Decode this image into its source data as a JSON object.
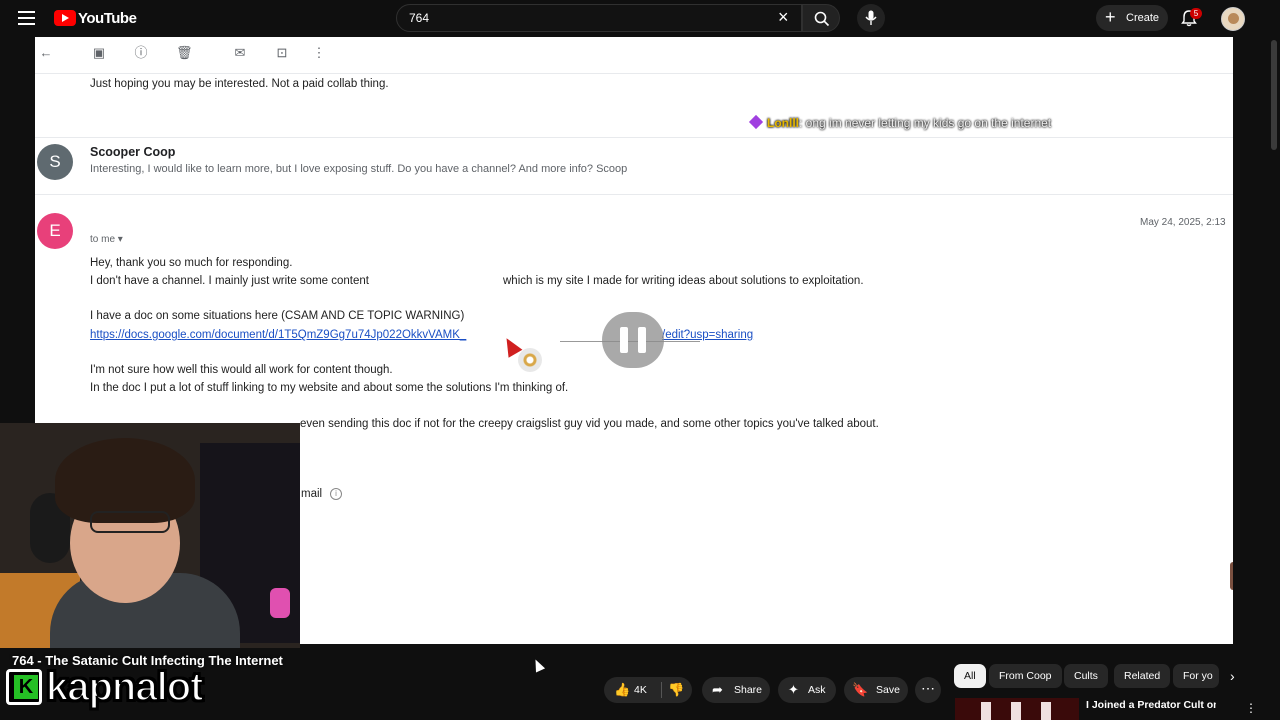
{
  "header": {
    "brand": "YouTube",
    "search_value": "764",
    "create_label": "Create",
    "notification_count": "5"
  },
  "email": {
    "top_line": "Just hoping you may be interested. Not a paid collab thing.",
    "chat": {
      "user": "Lonlll",
      "message": ": ong im never letting my kids go on the internet"
    },
    "reply1": {
      "avatar_letter": "S",
      "sender": "Scooper Coop",
      "snippet": "Interesting, I would like to learn more, but I love exposing stuff. Do you have a channel? And more info? Scoop"
    },
    "reply2": {
      "avatar_letter": "E",
      "to": "to me",
      "date": "May 24, 2025, 2:13",
      "line1": "Hey, thank you so much for responding.",
      "line2a": "I don't have a channel. I mainly just write some content",
      "line2b": "which is my site I made for writing ideas about solutions to exploitation.",
      "line3": "I have a doc on some situations here (CSAM AND CE TOPIC WARNING)",
      "link_a": "https://docs.google.com/document/d/1T5QmZ9Gg7u74Jp022OkkvVAMK_",
      "link_b": "/edit?usp=sharing",
      "line4": "I'm not sure how well this would all work for content though.",
      "line5": "In the doc I put a lot of stuff linking to my website and about some the solutions I'm thinking of.",
      "line6": "even sending this doc if not for the creepy craigslist guy vid you made, and some other topics you've talked about.",
      "footer": "mail"
    }
  },
  "video": {
    "title": "764 - The Satanic Cult Infecting The Internet",
    "overlay_brand": "kapnalot",
    "like_count": "4K",
    "share_label": "Share",
    "ask_label": "Ask",
    "save_label": "Save"
  },
  "chips": [
    "All",
    "From Coop",
    "Cults",
    "Related",
    "For yo"
  ],
  "recommendation": {
    "title": "I Joined a Predator Cult on Roblox"
  },
  "colors": {
    "youtube_red": "#ff0000",
    "link_blue": "#1a4fc4",
    "avatar_e": "#e8407a",
    "avatar_s": "#5f6a70"
  }
}
